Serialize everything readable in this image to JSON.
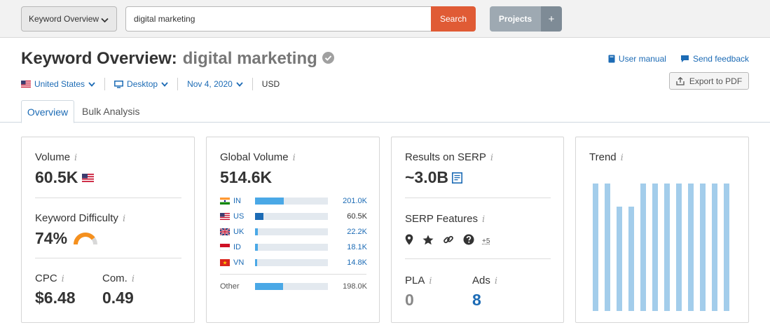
{
  "topbar": {
    "database_select": "Keyword Overview",
    "search_value": "digital marketing",
    "search_button": "Search",
    "projects_button": "Projects",
    "add_button": "+"
  },
  "header": {
    "title_prefix": "Keyword Overview:",
    "keyword": "digital marketing",
    "country": "United States",
    "device": "Desktop",
    "date": "Nov 4, 2020",
    "currency": "USD",
    "user_manual": "User manual",
    "send_feedback": "Send feedback",
    "export": "Export to PDF"
  },
  "tabs": [
    {
      "label": "Overview",
      "active": true
    },
    {
      "label": "Bulk Analysis",
      "active": false
    }
  ],
  "volume_card": {
    "volume_label": "Volume",
    "volume_value": "60.5K",
    "kd_label": "Keyword Difficulty",
    "kd_value": "74%",
    "kd_percent": 74,
    "cpc_label": "CPC",
    "cpc_value": "$6.48",
    "com_label": "Com.",
    "com_value": "0.49"
  },
  "global_card": {
    "label": "Global Volume",
    "value": "514.6K",
    "countries": [
      {
        "code": "IN",
        "value": "201.0K",
        "share": 0.39
      },
      {
        "code": "US",
        "value": "60.5K",
        "share": 0.12
      },
      {
        "code": "UK",
        "value": "22.2K",
        "share": 0.04
      },
      {
        "code": "ID",
        "value": "18.1K",
        "share": 0.035
      },
      {
        "code": "VN",
        "value": "14.8K",
        "share": 0.03
      }
    ],
    "other": {
      "label": "Other",
      "value": "198.0K",
      "share": 0.385
    }
  },
  "serp_card": {
    "results_label": "Results on SERP",
    "results_value": "~3.0B",
    "features_label": "SERP Features",
    "features_icons": [
      "map-pin-icon",
      "star-icon",
      "link-icon",
      "question-icon"
    ],
    "more": "+5",
    "pla_label": "PLA",
    "pla_value": "0",
    "ads_label": "Ads",
    "ads_value": "8"
  },
  "trend_card": {
    "label": "Trend",
    "values": [
      1,
      1,
      0.82,
      0.82,
      1,
      1,
      1,
      1,
      1,
      1,
      1,
      1
    ]
  },
  "colors": {
    "accent": "#e05b35",
    "link": "#1c6bb5",
    "bar": "#4aa8e6",
    "trend": "#a3cdeb",
    "kd_gauge": "#f5901e"
  }
}
